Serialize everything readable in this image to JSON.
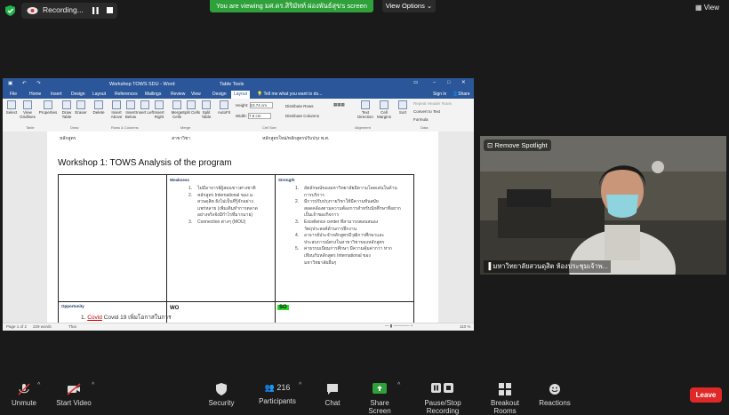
{
  "topbar": {
    "recording_label": "Recording...",
    "viewing_banner": "You are viewing มศ.ดร.สิริมัทท์ ผ่องพันธ์สุข's screen",
    "view_options": "View Options",
    "view_label": "View"
  },
  "word": {
    "title": "Workshop TOWS SDU - Word",
    "table_tools": "Table Tools",
    "tabs": [
      "File",
      "Home",
      "Insert",
      "Design",
      "Layout",
      "References",
      "Mailings",
      "Review",
      "View",
      "Design",
      "Layout"
    ],
    "tell_me": "Tell me what you want to do...",
    "sign_in": "Sign in",
    "share": "Share",
    "ribbon_buttons": [
      "Select",
      "View Gridlines",
      "Properties",
      "Draw Table",
      "Eraser",
      "Delete",
      "Insert Above",
      "Insert Below",
      "Insert Left",
      "Insert Right",
      "Merge Cells",
      "Split Cells",
      "Split Table",
      "AutoFit"
    ],
    "height_label": "Height:",
    "height_value": "10.74 cm",
    "width_label": "Width:",
    "width_value": "7.5 cm",
    "distribute_rows": "Distribute Rows",
    "distribute_columns": "Distribute Columns",
    "text_direction": "Text Direction",
    "cell_margins": "Cell Margins",
    "sort": "Sort",
    "repeat_header": "Repeat Header Rows",
    "convert_text": "Convert to Text",
    "formula": "Formula",
    "groups": [
      "Table",
      "Draw",
      "Rows & Columns",
      "Merge",
      "Cell Size",
      "Alignment",
      "Data"
    ],
    "doc_header": [
      "หลักสูตร",
      "สาขาวิชา",
      "หลักสูตรใหม่/หลักสูตรปรับปรุง พ.ศ."
    ],
    "workshop_title": "Workshop 1: TOWS Analysis of the program",
    "weakness_label": "Weakness",
    "strength_label": "Strength",
    "opportunity_label": "Opportunity",
    "wo_label": "WO",
    "so_label": "SO",
    "weakness_items": [
      {
        "n": "1.",
        "t": "ไม่มีอาจารย์ผู้สอนชาวต่างชาติ"
      },
      {
        "n": "2.",
        "t": "หลักสูตร International ของ ม."
      },
      {
        "n": "",
        "t": "สวนดุสิต ยังไม่เป็นที่รู้จักอย่าง"
      },
      {
        "n": "",
        "t": "แพร่หลาย (เพิ่มเติมทำการตลาด"
      },
      {
        "n": "",
        "t": "อย่างจริงจังมีกำไรที่มากมาย)"
      },
      {
        "n": "3.",
        "t": "Connection ต่างๆ (MOU)"
      }
    ],
    "strength_items": [
      {
        "n": "1.",
        "t": "อัตลักษณ์ของมหาวิทยาลัยมีความโดดเด่นในด้าน"
      },
      {
        "n": "",
        "t": "การบริการ"
      },
      {
        "n": "2.",
        "t": "มีการปรับปรุงรายวิชาให้มีความทันสมัย"
      },
      {
        "n": "",
        "t": "สอดคล้องตามความต้องการสำหรับนักศึกษาที่อยาก"
      },
      {
        "n": "",
        "t": "เป็นเจ้าของกิจการ"
      },
      {
        "n": "3.",
        "t": "Excellence center ที่สามารถตอบสนอง"
      },
      {
        "n": "",
        "t": "วัตถุประสงค์ด้านการฝึกงาน"
      },
      {
        "n": "4.",
        "t": "อาจารย์ประจำหลักสูตรมีวุฒิการศึกษาและ"
      },
      {
        "n": "",
        "t": "ประสบการณ์ตรงในสาขาวิชาของหลักสูตร"
      },
      {
        "n": "5.",
        "t": "ค่าธรรมเนียมการศึกษา มีความคุ้มค่ากว่า หาก"
      },
      {
        "n": "",
        "t": "เทียบกับหลักสูตร International ของ"
      },
      {
        "n": "",
        "t": "มหาวิทยาลัยอื่นๆ"
      }
    ],
    "opp_item": "Covid 19 เพิ่มโอกาสในการ",
    "status_page": "Page 1 of 2",
    "status_words": "229 words",
    "status_lang": "Thai",
    "zoom": "110 %"
  },
  "video": {
    "spotlight": "Remove Spotlight",
    "participant_name": "มหาวิทยาลัยสวนดุสิต ห้องประชุมเจ้าพ..."
  },
  "toolbar": {
    "unmute": "Unmute",
    "start_video": "Start Video",
    "security": "Security",
    "participants": "Participants",
    "participants_count": "216",
    "chat": "Chat",
    "share_screen": "Share Screen",
    "pause_stop": "Pause/Stop Recording",
    "breakout": "Breakout Rooms",
    "reactions": "Reactions",
    "leave": "Leave"
  },
  "colors": {
    "zoom_green": "#2fa13a",
    "word_blue": "#2b579a",
    "leave_red": "#e02828",
    "highlight": "#2dd82d"
  }
}
